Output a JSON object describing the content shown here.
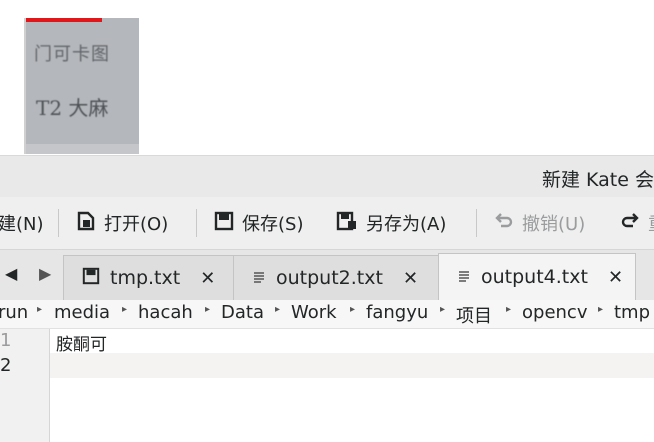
{
  "thumbnail": {
    "line1": "门可卡图",
    "line2": "T2 大麻"
  },
  "window": {
    "title": "新建 Kate 会"
  },
  "toolbar": {
    "new_label": "建(N)",
    "open_label": "打开(O)",
    "save_label": "保存(S)",
    "save_as_label": "另存为(A)",
    "undo_label": "撤销(U)",
    "redo_label": "重"
  },
  "tabs": [
    {
      "label": "tmp.txt",
      "close": "✕"
    },
    {
      "label": "output2.txt",
      "close": "✕"
    },
    {
      "label": "output4.txt",
      "close": "✕"
    }
  ],
  "breadcrumb": [
    "run",
    "media",
    "hacah",
    "Data",
    "Work",
    "fangyu",
    "项目",
    "opencv",
    "tmp"
  ],
  "editor": {
    "line_numbers": [
      "1",
      "2"
    ],
    "lines": [
      "胺酮可",
      ""
    ]
  },
  "colors": {
    "titlebar": "#e9e9ea",
    "toolbar": "#efefef",
    "active_tab": "#f4f4f4",
    "thumbnail_red": "#e0161b"
  }
}
